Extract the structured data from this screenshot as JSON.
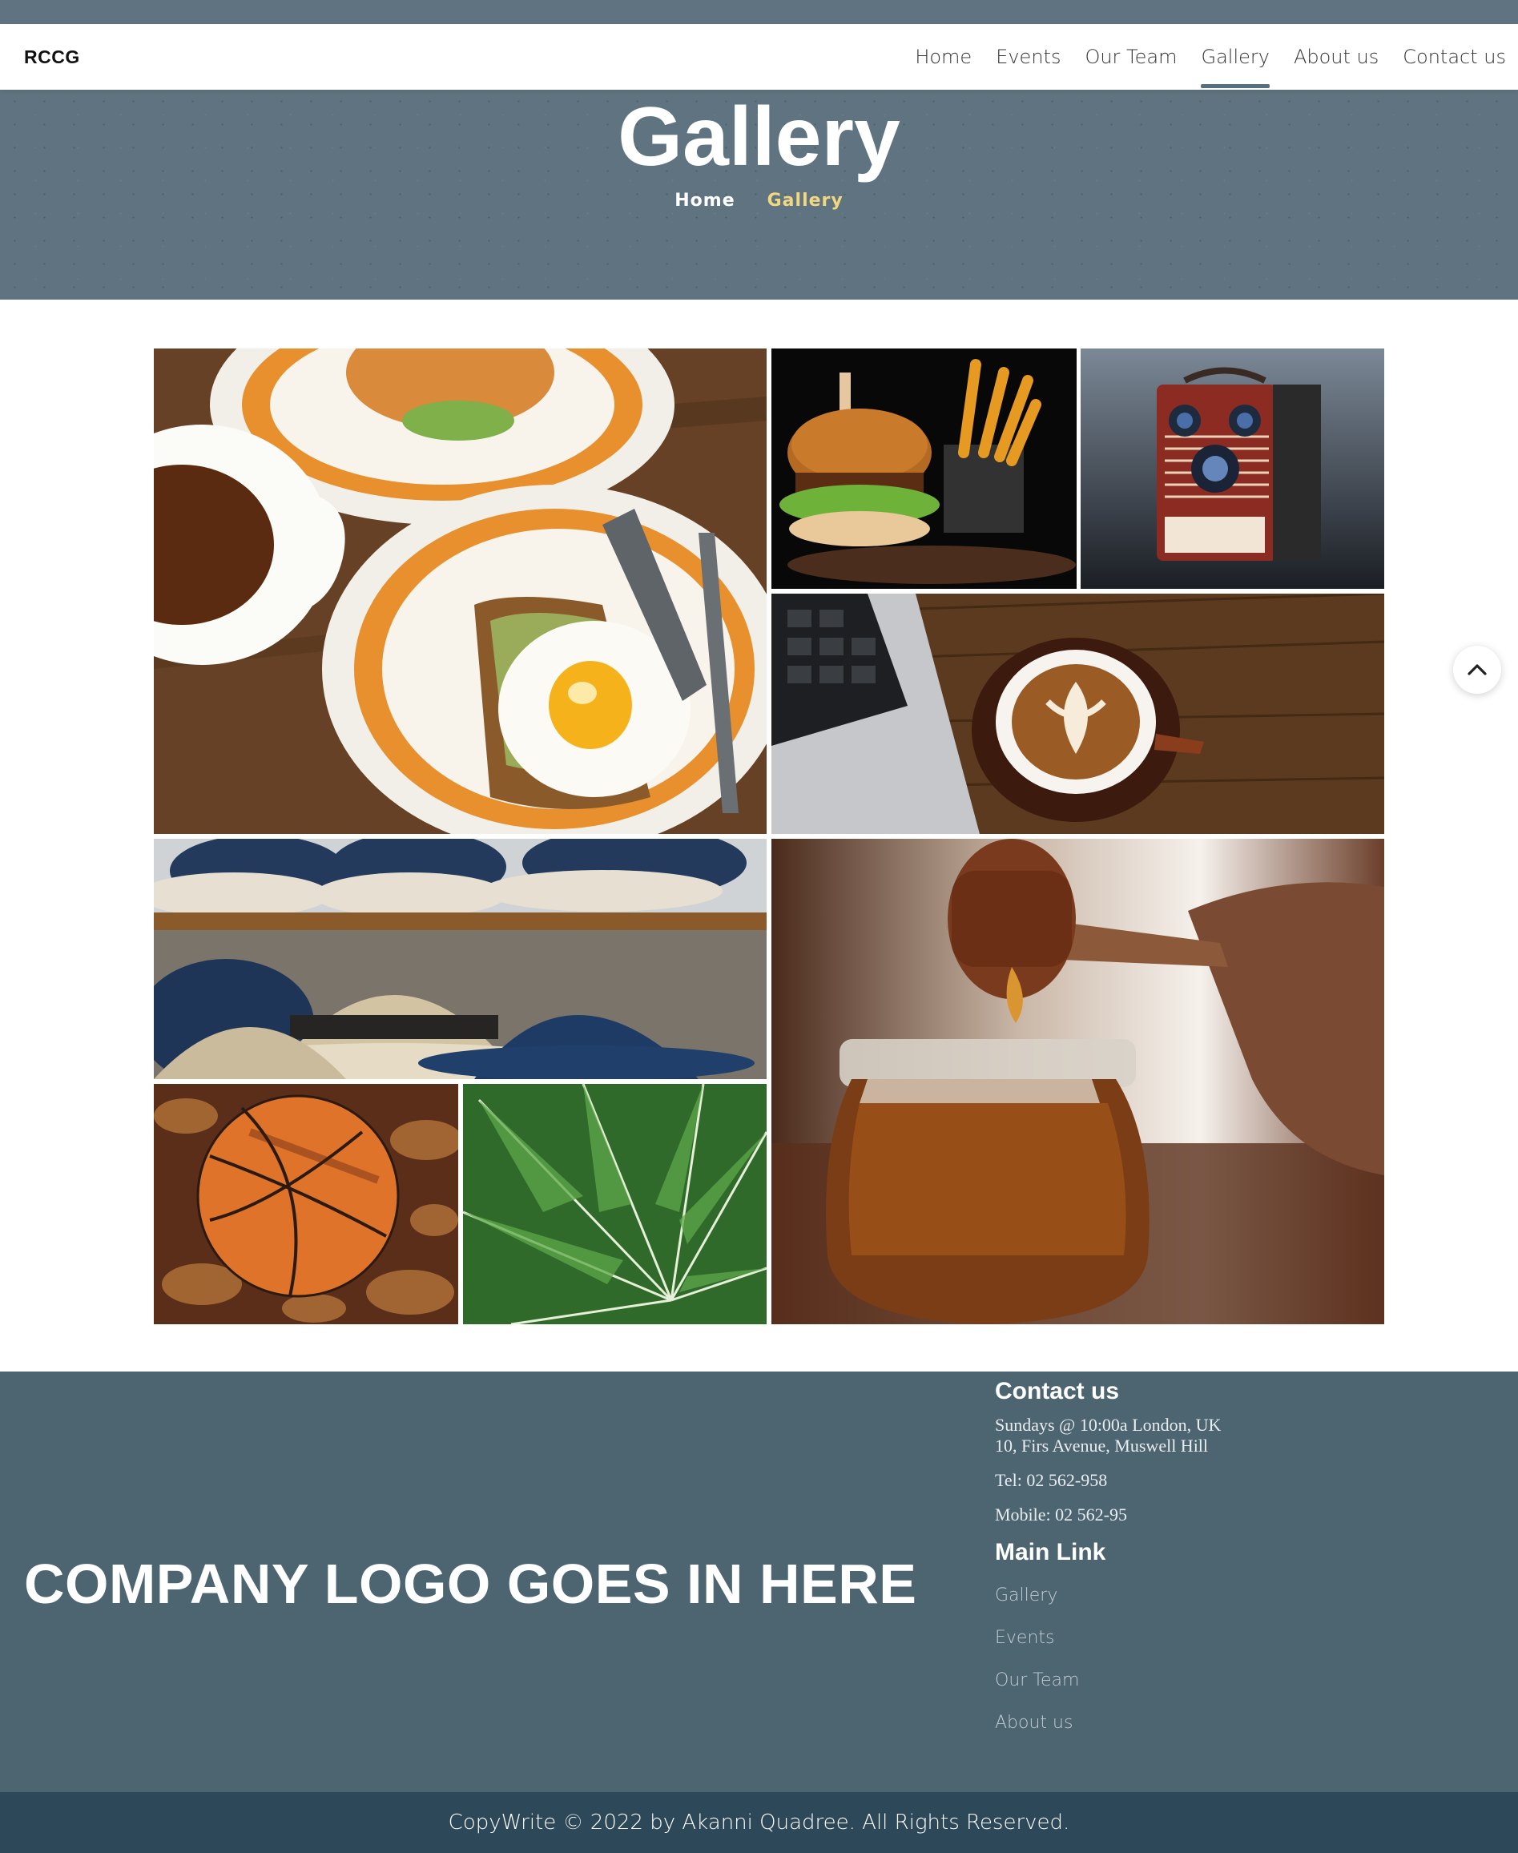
{
  "nav": {
    "brand": "RCCG",
    "links": [
      {
        "label": "Home"
      },
      {
        "label": "Events"
      },
      {
        "label": "Our Team"
      },
      {
        "label": "Gallery",
        "active": true
      },
      {
        "label": "About us"
      },
      {
        "label": "Contact us"
      }
    ]
  },
  "hero": {
    "title": "Gallery",
    "breadcrumb_home": "Home",
    "breadcrumb_current": "Gallery"
  },
  "gallery": {
    "images": [
      {
        "subject": "breakfast-plates-with-coffee"
      },
      {
        "subject": "burger-and-fries"
      },
      {
        "subject": "vintage-brownie-camera"
      },
      {
        "subject": "latte-art-coffee-beside-laptop"
      },
      {
        "subject": "hats-on-shelf"
      },
      {
        "subject": "honey-dipper-over-jar"
      },
      {
        "subject": "basketball-in-leaves"
      },
      {
        "subject": "green-fern-leaves"
      }
    ]
  },
  "footer": {
    "logo_text": "COMPANY LOGO GOES IN HERE",
    "contact_heading": "Contact us",
    "address": "Sundays @ 10:00a London, UK 10, Firs Avenue, Muswell Hill",
    "tel": "Tel: 02 562-958",
    "mobile": "Mobile: 02 562-95",
    "links_heading": "Main Link",
    "links": [
      {
        "label": "Gallery"
      },
      {
        "label": "Events"
      },
      {
        "label": "Our Team"
      },
      {
        "label": "About us"
      }
    ],
    "copyright": "CopyWrite © 2022 by Akanni Quadree. All Rights Reserved."
  },
  "colors": {
    "hero_bg": "#5f7480",
    "footer_bg": "#4d6471",
    "copyright_bg": "#2d4858",
    "breadcrumb_accent": "#f2d780"
  },
  "icons": {
    "scroll_top": "chevron-up-icon"
  }
}
